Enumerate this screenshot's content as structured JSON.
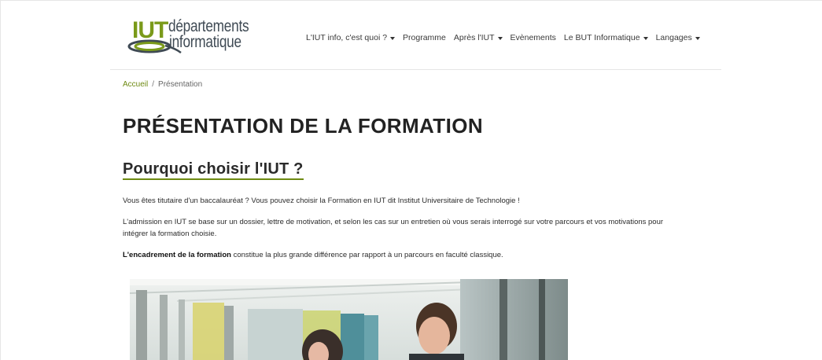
{
  "logo": {
    "iut": "IUT",
    "line1": "départements",
    "line2": "informatique"
  },
  "nav": {
    "items": [
      {
        "label": "L'IUT info, c'est quoi ?",
        "dropdown": true
      },
      {
        "label": "Programme",
        "dropdown": false
      },
      {
        "label": "Après l'IUT",
        "dropdown": true
      },
      {
        "label": "Evènements",
        "dropdown": false
      },
      {
        "label": "Le BUT Informatique",
        "dropdown": true
      },
      {
        "label": "Langages",
        "dropdown": true
      }
    ]
  },
  "breadcrumb": {
    "home": "Accueil",
    "separator": "/",
    "current": "Présentation"
  },
  "page": {
    "title": "PRÉSENTATION DE LA FORMATION",
    "section_title": "Pourquoi choisir l'IUT ?",
    "p1": "Vous êtes titutaire d'un baccalauréat ? Vous pouvez choisir la Formation en IUT dit Institut Universitaire de Technologie !",
    "p2": "L'admission en IUT se base sur un dossier, lettre de motivation, et selon les cas sur un entretien où vous serais interrogé sur votre parcours et vos motivations pour intégrer la formation choisie.",
    "p3_bold": "L'encadrement de la formation",
    "p3_rest": " constitue la plus grande différence par rapport à un parcours en faculté classique."
  },
  "colors": {
    "accent": "#6e8a12",
    "logo_green": "#7a9a1a",
    "text": "#212529"
  }
}
